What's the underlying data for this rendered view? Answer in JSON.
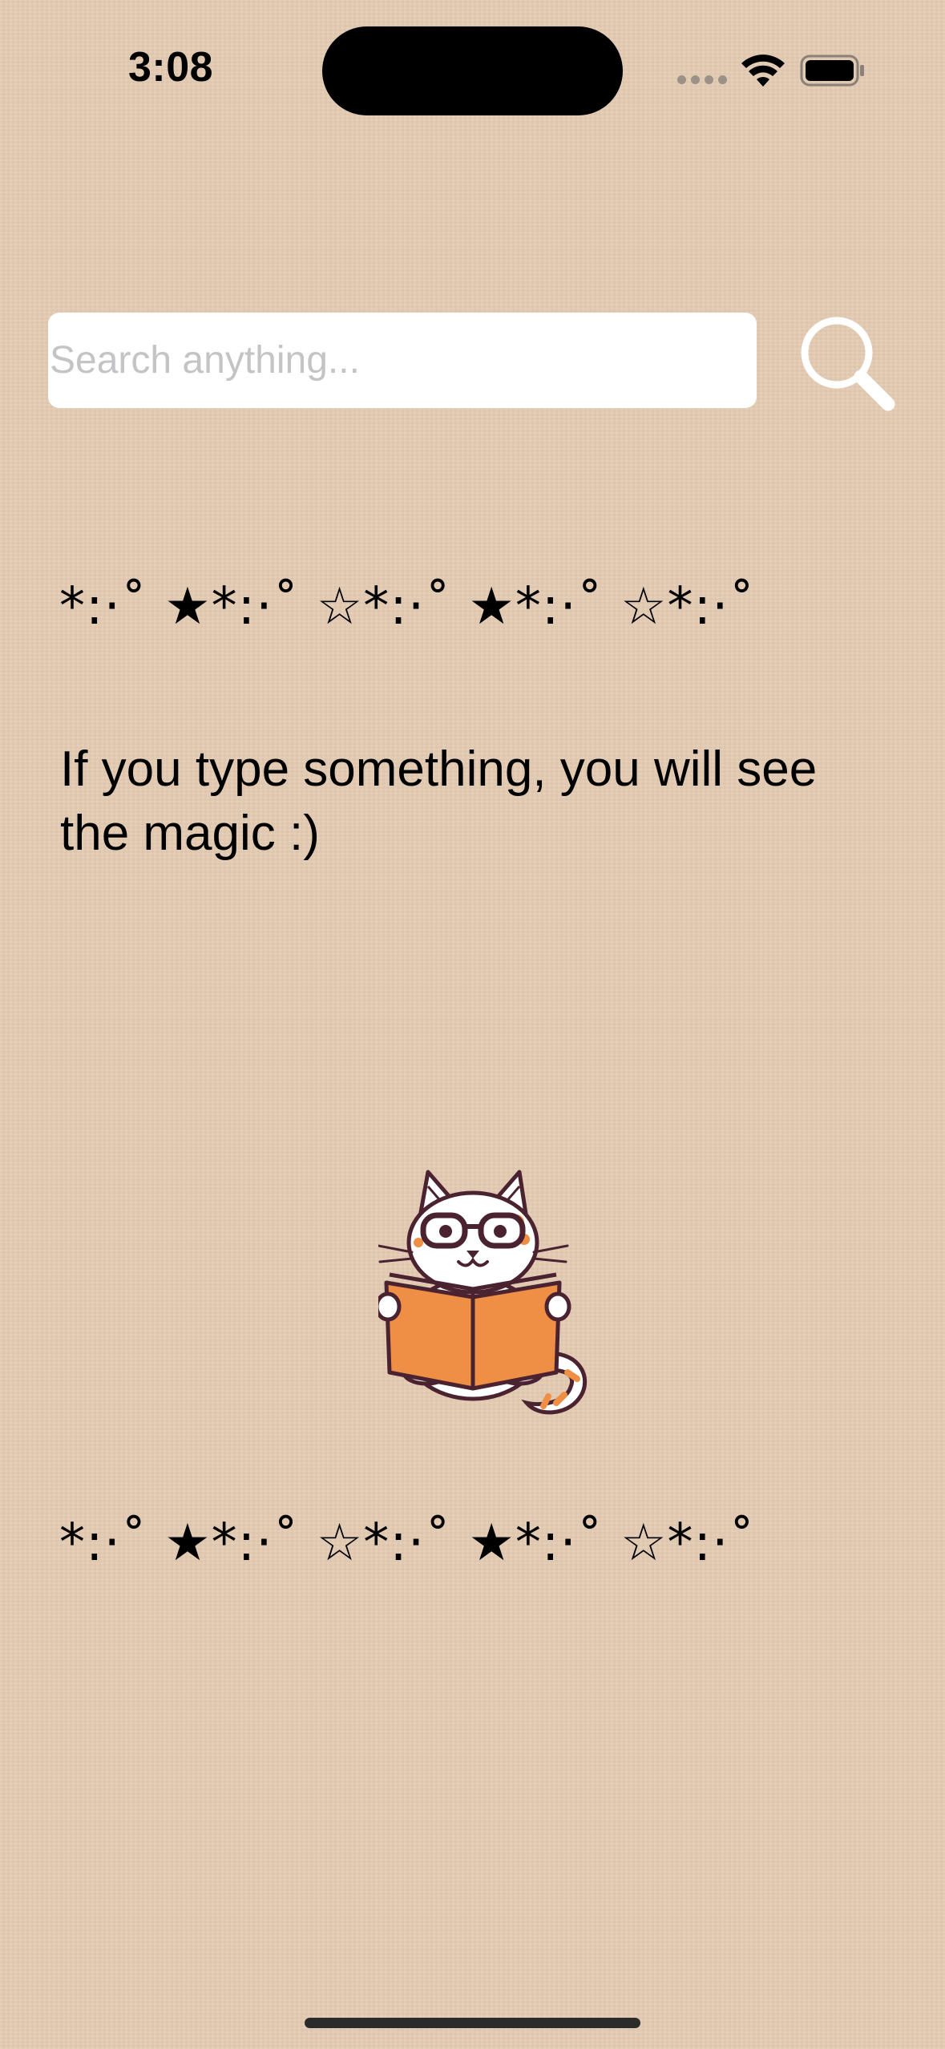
{
  "status_bar": {
    "time": "3:08"
  },
  "search": {
    "placeholder": "Search anything...",
    "value": "",
    "button_icon": "magnifying-glass"
  },
  "decoration": {
    "stars_top": "*:·˚ ★*:·˚ ☆*:·˚ ★*:·˚ ☆*:·˚",
    "stars_bottom": "*:·˚ ★*:·˚ ☆*:·˚ ★*:·˚ ☆*:·˚"
  },
  "message": "If you type something, you will see the magic :)",
  "illustration": {
    "icon": "cat-reading-book",
    "colors": {
      "book": "#ef8f45",
      "outline": "#4a2230",
      "spots": "#ef8f45"
    }
  },
  "colors": {
    "background": "#e4cbb3",
    "input_background": "#ffffff",
    "placeholder": "#c4c4c6",
    "search_icon": "#ffffff"
  }
}
